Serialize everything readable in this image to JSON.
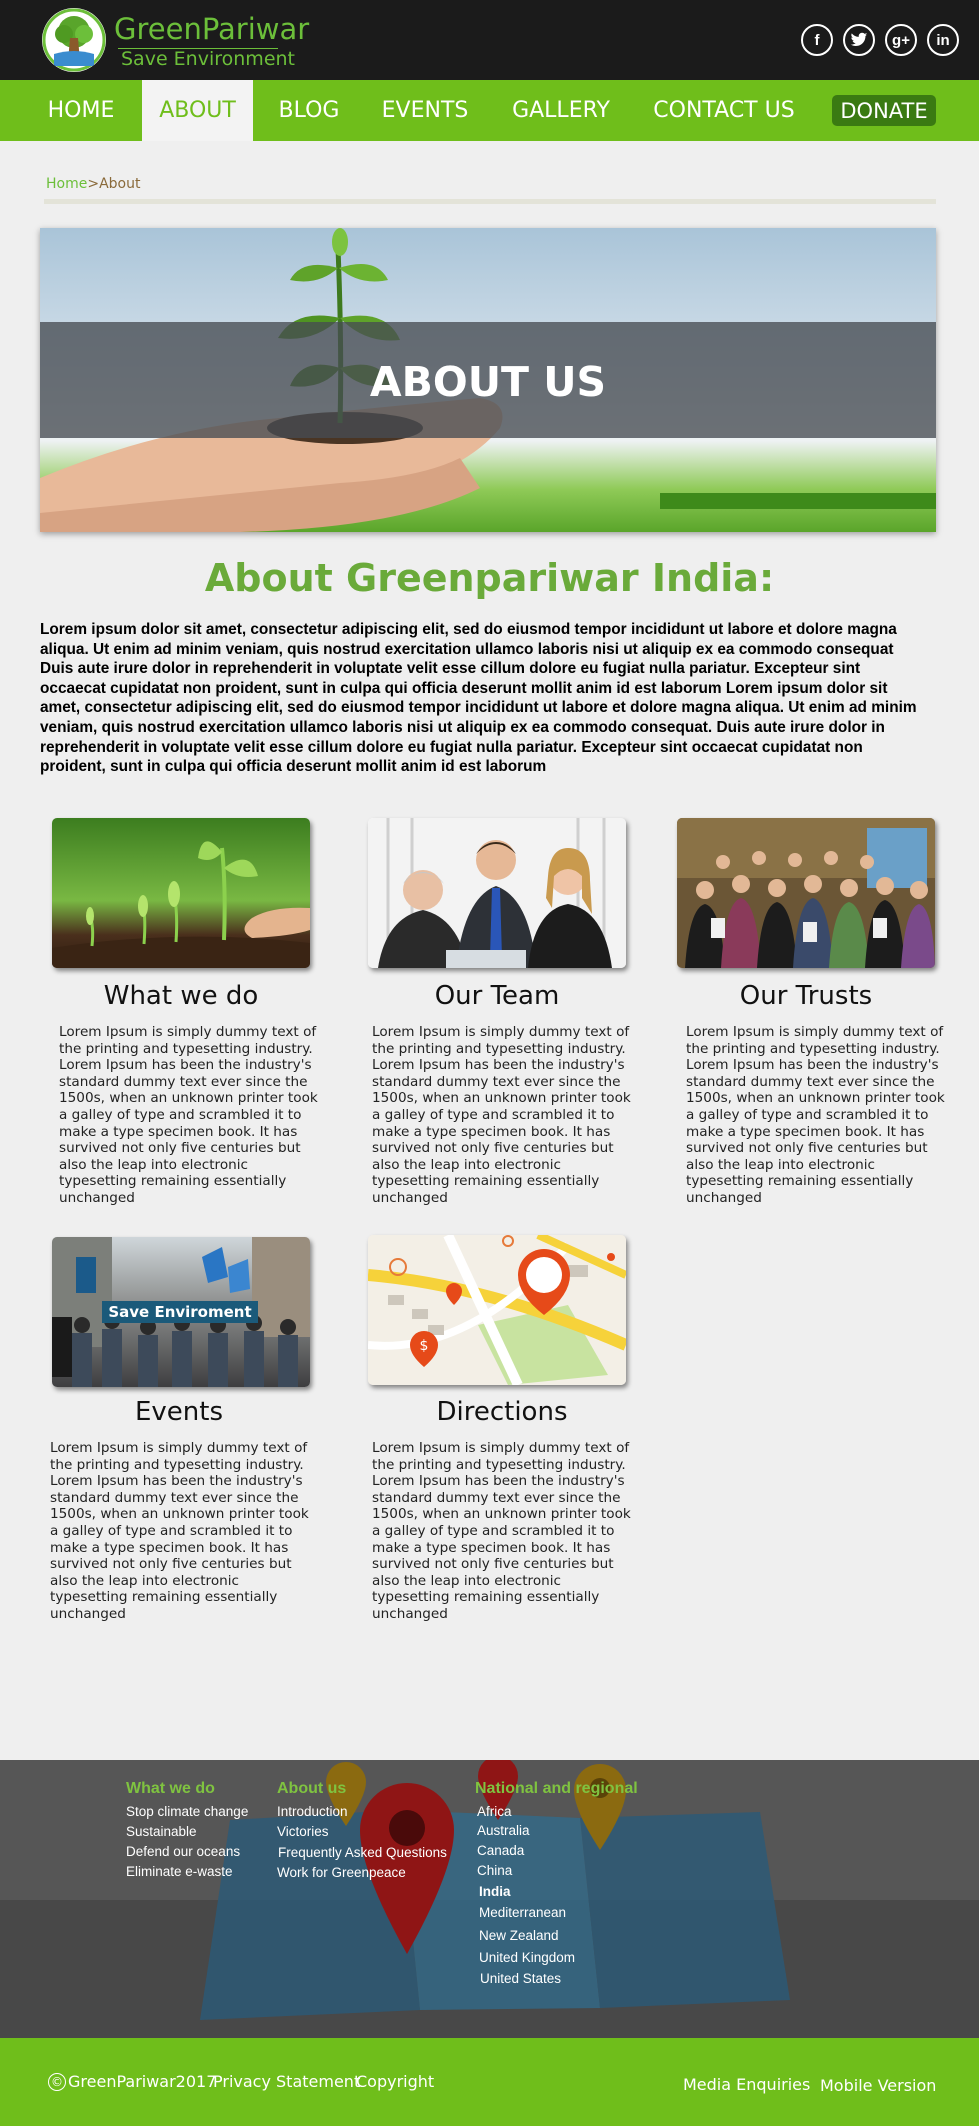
{
  "header": {
    "brand_name": "GreenPariwar",
    "brand_tagline": "Save Environment",
    "social": [
      {
        "icon": "facebook-icon",
        "glyph": "f"
      },
      {
        "icon": "twitter-icon",
        "glyph": "t"
      },
      {
        "icon": "google-plus-icon",
        "glyph": "g+"
      },
      {
        "icon": "linkedin-icon",
        "glyph": "in"
      }
    ]
  },
  "nav": {
    "items": [
      "HOME",
      "ABOUT",
      "BLOG",
      "EVENTS",
      "GALLERY",
      "CONTACT US"
    ],
    "active": "ABOUT",
    "donate": "DONATE",
    "accent_color": "#6fbe1b"
  },
  "breadcrumb": {
    "home": "Home",
    "separator": ">",
    "current": "About"
  },
  "hero": {
    "title": "ABOUT US"
  },
  "about": {
    "heading": "About Greenpariwar India:",
    "body": "Lorem ipsum dolor sit amet, consectetur adipiscing elit, sed do eiusmod tempor incididunt ut labore et dolore magna aliqua. Ut enim ad minim veniam, quis nostrud exercitation ullamco laboris nisi ut aliquip ex ea commodo consequat Duis aute irure dolor in reprehenderit in voluptate velit esse cillum dolore eu fugiat nulla pariatur. Excepteur sint occaecat cupidatat non proident, sunt in culpa qui officia deserunt mollit anim id est laborum Lorem ipsum dolor sit amet, consectetur adipiscing elit, sed do eiusmod tempor incididunt ut labore et dolore magna aliqua. Ut enim ad minim veniam, quis nostrud exercitation ullamco laboris nisi ut aliquip ex ea commodo consequat. Duis aute irure dolor in reprehenderit in voluptate velit esse cillum dolore eu fugiat nulla pariatur. Excepteur sint occaecat cupidatat non proident, sunt in culpa qui officia deserunt mollit anim id est laborum"
  },
  "cards": [
    {
      "title": "What we do",
      "text": "Lorem Ipsum is simply dummy text of the printing and typesetting industry. Lorem Ipsum has been the industry's standard dummy text ever since the 1500s, when an unknown printer took a galley of type and scrambled it to make a type specimen book. It has survived not only five centuries but also the leap into electronic typesetting remaining essentially unchanged"
    },
    {
      "title": "Our Team",
      "text": "Lorem Ipsum is simply dummy text of the printing and typesetting industry. Lorem Ipsum has been the industry's standard dummy text ever since the 1500s, when an unknown printer took a galley of type and scrambled it to make a type specimen book. It has survived not only five centuries but also the leap into electronic typesetting remaining essentially unchanged"
    },
    {
      "title": "Our Trusts",
      "text": "Lorem Ipsum is simply dummy text of the printing and typesetting industry. Lorem Ipsum has been the industry's standard dummy text ever since the 1500s, when an unknown printer took a galley of type and scrambled it to make a type specimen book. It has survived not only five centuries but also the leap into electronic typesetting remaining essentially unchanged"
    },
    {
      "title": "Events",
      "image_caption": "Save Enviroment",
      "text": "Lorem Ipsum is simply dummy text of the printing and typesetting industry. Lorem Ipsum has been the industry's standard dummy text ever since the 1500s, when an unknown printer took a galley of type and scrambled it to make a type specimen book. It has survived not only five centuries but also the leap into electronic typesetting remaining essentially unchanged"
    },
    {
      "title": "Directions",
      "text": "Lorem Ipsum is simply dummy text of the printing and typesetting industry. Lorem Ipsum has been the industry's standard dummy text ever since the 1500s, when an unknown printer took a galley of type and scrambled it to make a type specimen book. It has survived not only five centuries but also the leap into electronic typesetting remaining essentially unchanged"
    }
  ],
  "footer": {
    "columns": [
      {
        "heading": "What we do",
        "items": [
          "Stop climate change",
          "Sustainable",
          "Defend our oceans",
          "Eliminate e-waste"
        ]
      },
      {
        "heading": "About us",
        "items": [
          "Introduction",
          "Victories",
          "Frequently Asked Questions",
          "Work for Greenpeace"
        ]
      },
      {
        "heading": "National and regional",
        "items": [
          "Africa",
          "Australia",
          "Canada",
          "China",
          "India",
          "Mediterranean",
          "New Zealand",
          "United Kingdom",
          "United States"
        ]
      }
    ],
    "copyright_symbol": "©",
    "copyright": "GreenPariwar2017",
    "privacy": "Privacy Statement",
    "copyright_link": "Copyright",
    "media": "Media Enquiries",
    "mobile": "Mobile Version"
  }
}
